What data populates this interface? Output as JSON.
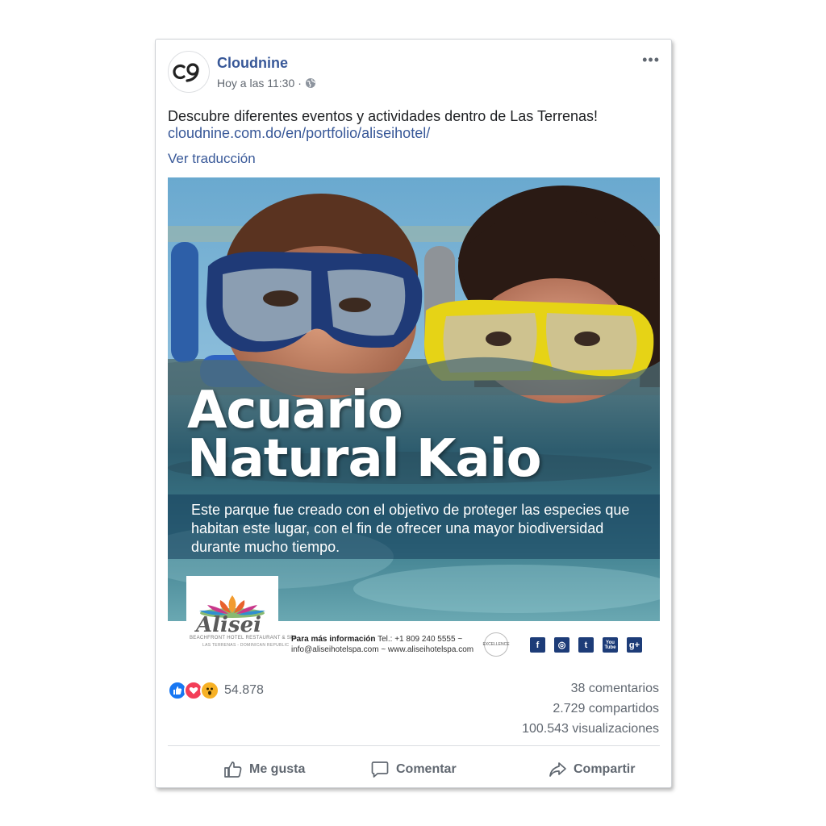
{
  "post": {
    "page_name": "Cloudnine",
    "avatar_text": "c9",
    "timestamp": "Hoy a las 11:30",
    "separator": "·",
    "more": "•••",
    "text": "Descubre diferentes eventos y actividades dentro de Las Terrenas!",
    "link": "cloudnine.com.do/en/portfolio/aliseihotel/",
    "translate": "Ver traducción"
  },
  "image": {
    "title_line1": "Acuario",
    "title_line2": "Natural Kaio",
    "description": "Este parque fue creado con el objetivo de proteger las especies que habitan este lugar, con el fin de ofrecer una mayor biodiversidad durante mucho tiempo.",
    "logo_name": "Alisei",
    "logo_sub1": "BEACHFRONT HOTEL RESTAURANT & SPA",
    "logo_sub2": "LAS TERRENAS - DOMINICAN REPUBLIC",
    "info_label": "Para más información",
    "info_phone": " Tel.: +1 809 240 5555 ~",
    "info_line2": "info@aliseihotelspa.com ~ www.aliseihotelspa.com",
    "tripadvisor": "EXCELLENCE",
    "social": [
      "f",
      "◎",
      "t",
      "You Tube",
      "g+"
    ]
  },
  "stats": {
    "reaction_count": "54.878",
    "comments": "38 comentarios",
    "shares": "2.729 compartidos",
    "views": "100.543 visualizaciones"
  },
  "actions": {
    "like": "Me gusta",
    "comment": "Comentar",
    "share": "Compartir"
  },
  "colors": {
    "link": "#385898",
    "like": "#1877f2",
    "love": "#f33e58",
    "wow": "#f7b125"
  }
}
